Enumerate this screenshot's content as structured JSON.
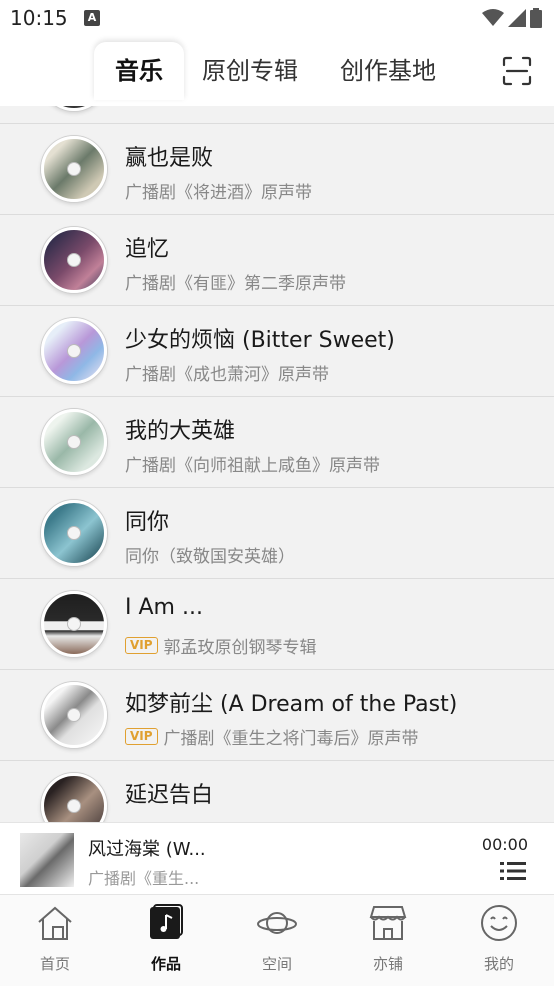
{
  "status": {
    "time": "10:15",
    "notif_icon": "a-notification-icon"
  },
  "tabs": [
    {
      "label": "音乐",
      "active": true
    },
    {
      "label": "原创专辑",
      "active": false
    },
    {
      "label": "创作基地",
      "active": false
    }
  ],
  "songs": [
    {
      "title": "赢也是败",
      "subtitle": "广播剧《将进酒》原声带",
      "vip": false,
      "cover_colors": [
        "#d9d6c9",
        "#6b7a6a"
      ]
    },
    {
      "title": "追忆",
      "subtitle": "广播剧《有匪》第二季原声带",
      "vip": false,
      "cover_colors": [
        "#3a3a5a",
        "#a0607a"
      ]
    },
    {
      "title": "少女的烦恼 (Bitter Sweet)",
      "subtitle": "广播剧《成也萧河》原声带",
      "vip": false,
      "cover_colors": [
        "#dbe6f5",
        "#b08ad0"
      ]
    },
    {
      "title": "我的大英雄",
      "subtitle": "广播剧《向师祖献上咸鱼》原声带",
      "vip": false,
      "cover_colors": [
        "#e6efe8",
        "#8aa89a"
      ]
    },
    {
      "title": "同你",
      "subtitle": "同你（致敬国安英雄）",
      "vip": false,
      "cover_colors": [
        "#4a8a98",
        "#b0d8e0"
      ]
    },
    {
      "title": "I Am ...",
      "subtitle": "郭孟玫原创钢琴专辑",
      "vip": true,
      "vip_label": "VIP",
      "cover_colors": [
        "#222222",
        "#e8e8e8"
      ]
    },
    {
      "title": "如梦前尘 (A Dream of the Past)",
      "subtitle": "广播剧《重生之将门毒后》原声带",
      "vip": true,
      "vip_label": "VIP",
      "cover_colors": [
        "#f0f0f0",
        "#7a7a7a"
      ]
    },
    {
      "title": "延迟告白",
      "subtitle": "",
      "vip": false,
      "cover_colors": [
        "#3a3030",
        "#c8b8a8"
      ]
    }
  ],
  "player": {
    "title": "风过海棠 (W...",
    "subtitle": "广播剧《重生...",
    "time": "00:00"
  },
  "bottom_nav": [
    {
      "label": "首页",
      "icon": "house-icon",
      "active": false
    },
    {
      "label": "作品",
      "icon": "music-note-icon",
      "active": true
    },
    {
      "label": "空间",
      "icon": "planet-icon",
      "active": false
    },
    {
      "label": "亦铺",
      "icon": "shop-icon",
      "active": false
    },
    {
      "label": "我的",
      "icon": "smiley-icon",
      "active": false
    }
  ]
}
